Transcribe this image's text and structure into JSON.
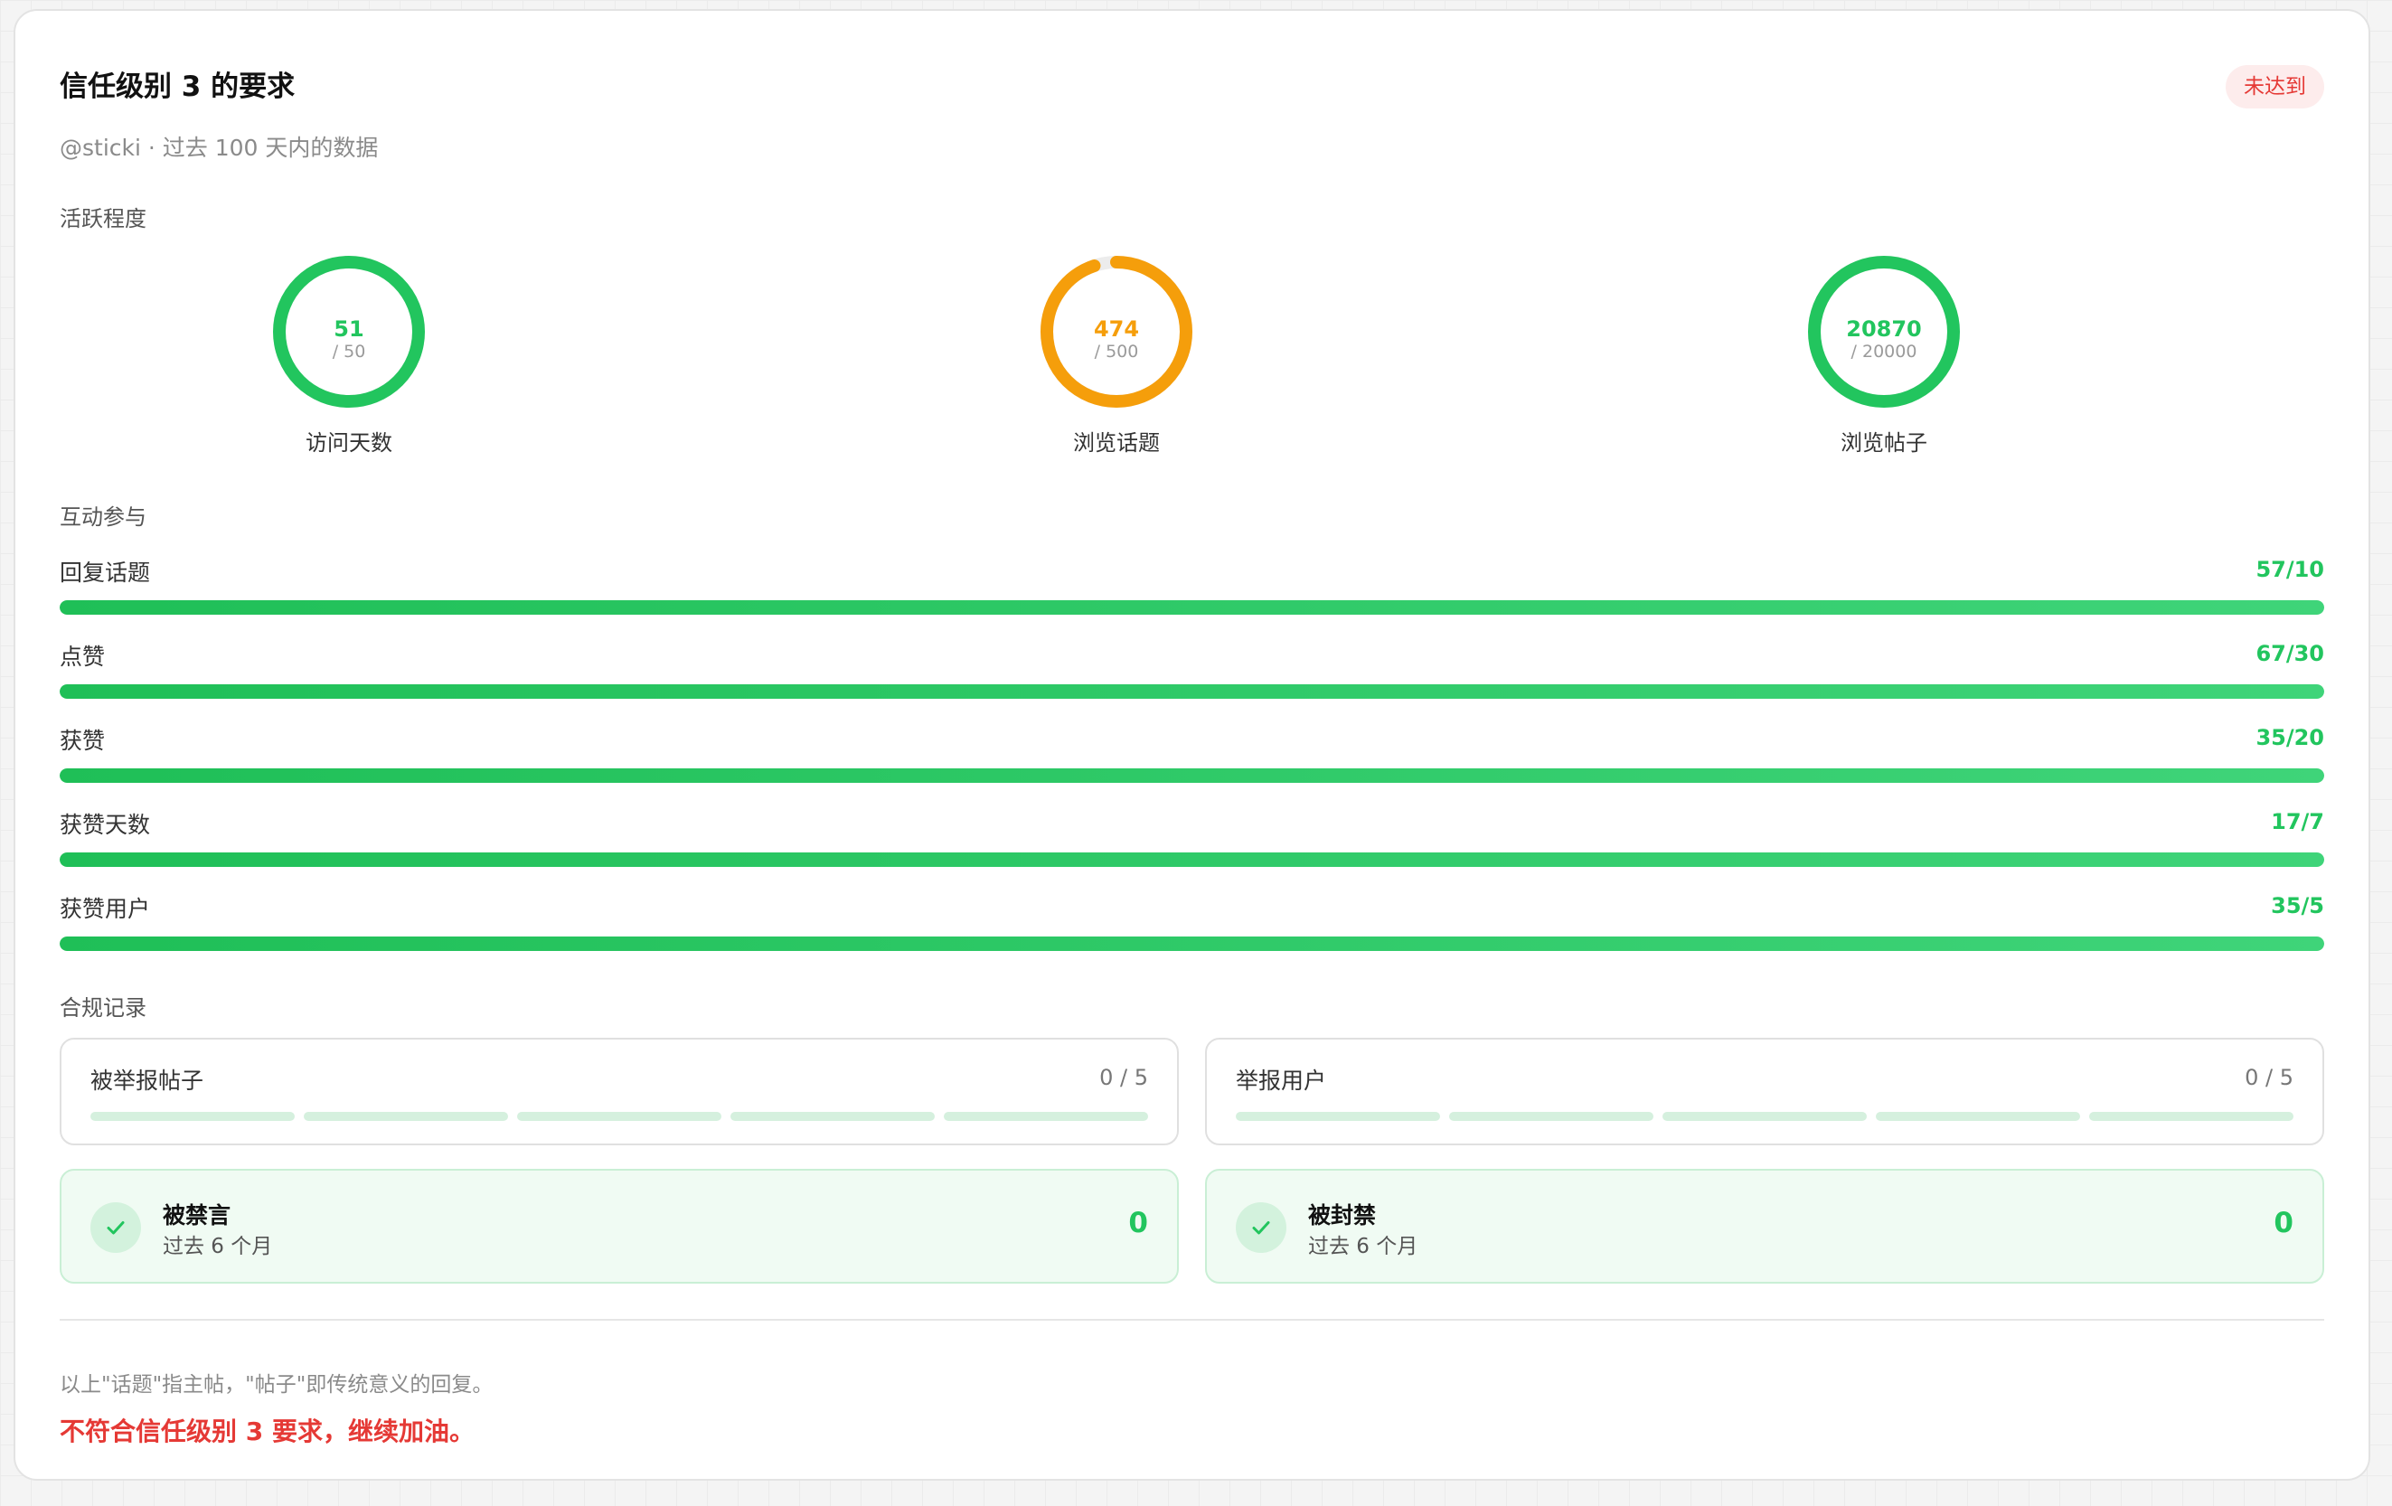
{
  "card": {
    "title": "信任级别 3 的要求",
    "status_badge": "未达到",
    "subtitle": "@sticki · 过去 100 天内的数据"
  },
  "activity": {
    "section_label": "活跃程度",
    "gauges": [
      {
        "label": "访问天数",
        "value": "51",
        "target": "/ 50",
        "progress": 1.0,
        "color": "#22c55e"
      },
      {
        "label": "浏览话题",
        "value": "474",
        "target": "/ 500",
        "progress": 0.948,
        "color": "#f59e0b"
      },
      {
        "label": "浏览帖子",
        "value": "20870",
        "target": "/ 20000",
        "progress": 1.0,
        "color": "#22c55e"
      }
    ]
  },
  "interaction": {
    "section_label": "互动参与",
    "bars": [
      {
        "label": "回复话题",
        "count": "57/10",
        "progress": 1.0
      },
      {
        "label": "点赞",
        "count": "67/30",
        "progress": 1.0
      },
      {
        "label": "获赞",
        "count": "35/20",
        "progress": 1.0
      },
      {
        "label": "获赞天数",
        "count": "17/7",
        "progress": 1.0
      },
      {
        "label": "获赞用户",
        "count": "35/5",
        "progress": 1.0
      }
    ]
  },
  "compliance": {
    "section_label": "合规记录",
    "reported_posts": {
      "label": "被举报帖子",
      "count": "0 / 5",
      "filled": 0,
      "total": 5
    },
    "reported_users": {
      "label": "举报用户",
      "count": "0 / 5",
      "filled": 0,
      "total": 5
    },
    "silenced": {
      "title": "被禁言",
      "sub": "过去 6 个月",
      "count": "0"
    },
    "suspended": {
      "title": "被封禁",
      "sub": "过去 6 个月",
      "count": "0"
    }
  },
  "footer": {
    "note": "以上\"话题\"指主帖，\"帖子\"即传统意义的回复。",
    "conclusion": "不符合信任级别 3 要求，继续加油。"
  },
  "colors": {
    "success": "#22c55e",
    "warning": "#f59e0b",
    "danger": "#e53935"
  },
  "icons": {
    "check": "check-icon"
  }
}
